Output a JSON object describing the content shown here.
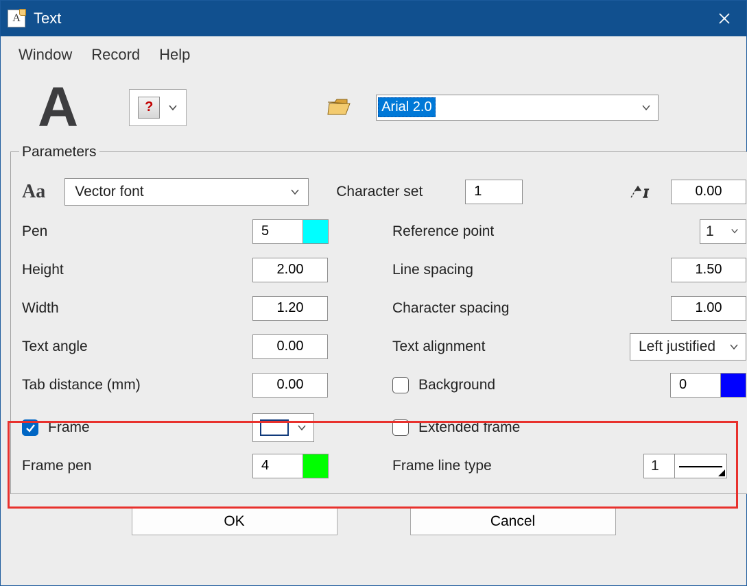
{
  "window": {
    "title": "Text"
  },
  "menu": {
    "window": "Window",
    "record": "Record",
    "help": "Help"
  },
  "top": {
    "unknown_style": "?",
    "font_profile": "Arial 2.0"
  },
  "params": {
    "legend": "Parameters",
    "aa_label": "Aa",
    "font_type": "Vector font",
    "charset_label": "Character set",
    "charset_value": "1",
    "italic_value": "0.00",
    "pen_label": "Pen",
    "pen_value": "5",
    "refpoint_label": "Reference point",
    "refpoint_value": "1",
    "height_label": "Height",
    "height_value": "2.00",
    "linespacing_label": "Line spacing",
    "linespacing_value": "1.50",
    "width_label": "Width",
    "width_value": "1.20",
    "charspacing_label": "Character spacing",
    "charspacing_value": "1.00",
    "textangle_label": "Text angle",
    "textangle_value": "0.00",
    "textalign_label": "Text alignment",
    "textalign_value": "Left justified",
    "tabdist_label": "Tab distance (mm)",
    "tabdist_value": "0.00",
    "background_label": "Background",
    "background_value": "0",
    "frame_label": "Frame",
    "frame_checked": true,
    "extframe_label": "Extended frame",
    "extframe_checked": false,
    "framepen_label": "Frame pen",
    "framepen_value": "4",
    "framelinetype_label": "Frame line type",
    "framelinetype_value": "1"
  },
  "colors": {
    "pen": "#00ffff",
    "background": "#0000ff",
    "frame_pen": "#00ff00"
  },
  "buttons": {
    "ok": "OK",
    "cancel": "Cancel"
  }
}
